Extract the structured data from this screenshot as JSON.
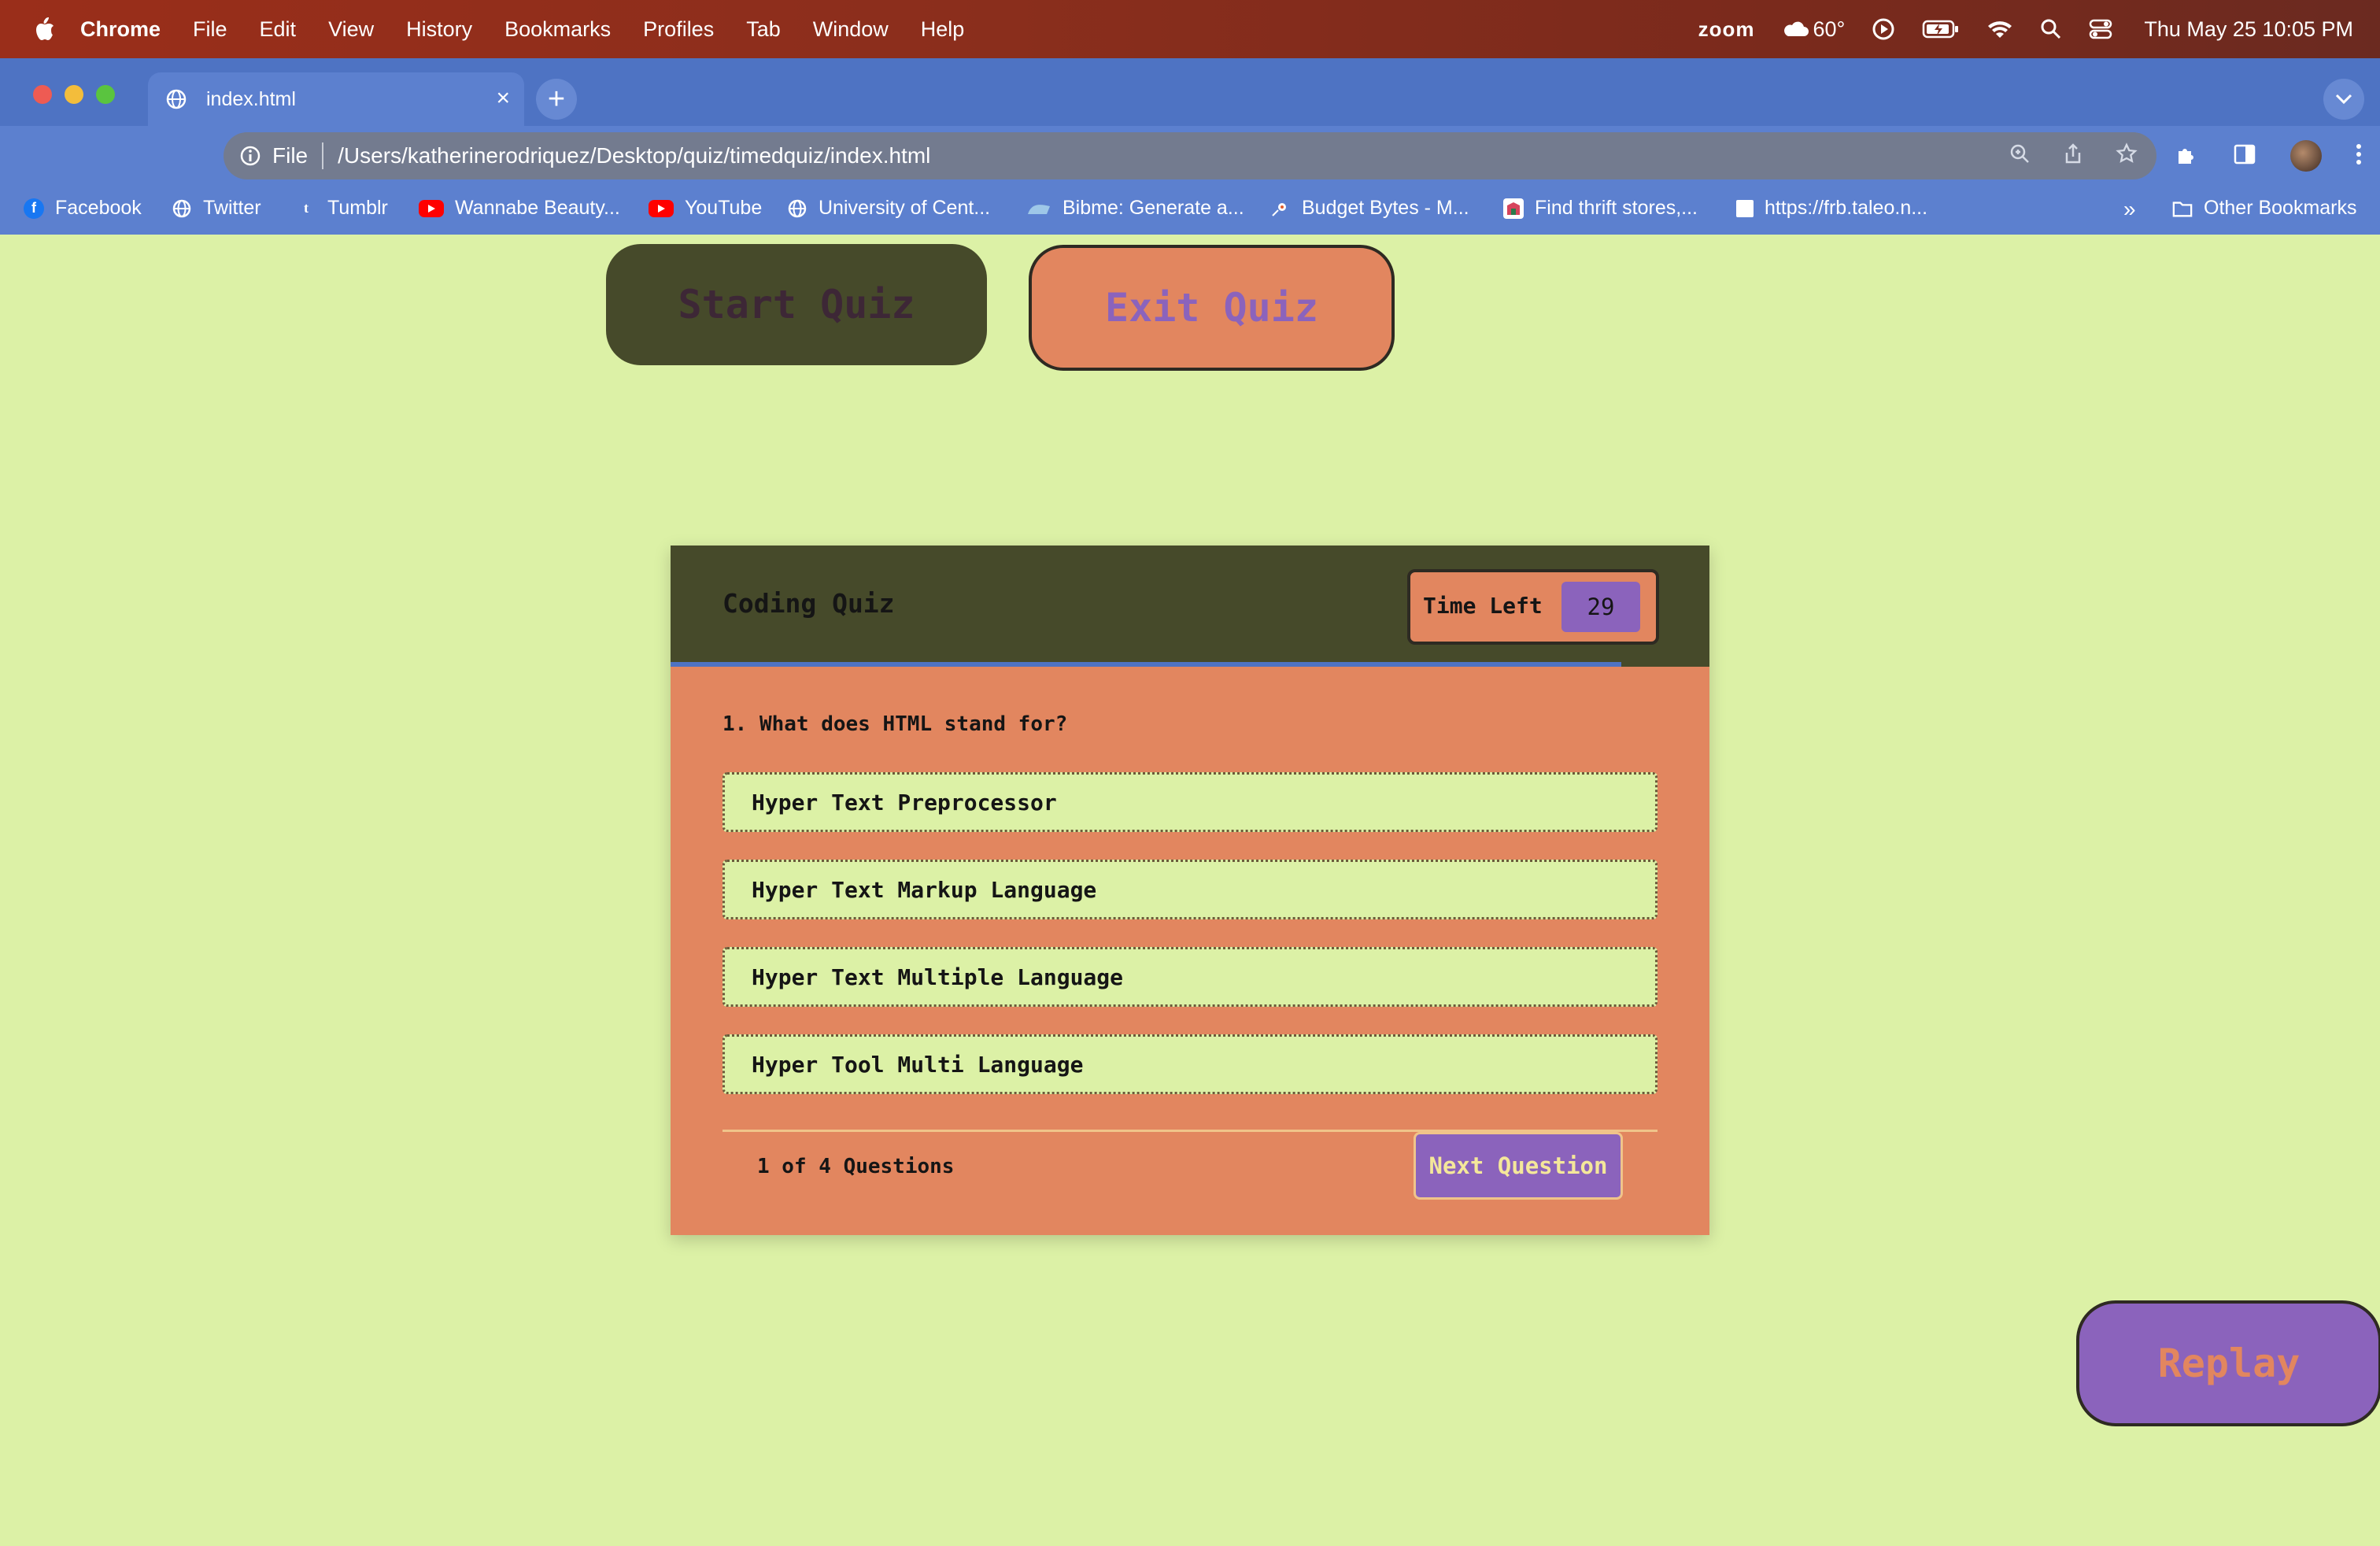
{
  "menubar": {
    "app_name": "Chrome",
    "menus": [
      "File",
      "Edit",
      "View",
      "History",
      "Bookmarks",
      "Profiles",
      "Tab",
      "Window",
      "Help"
    ],
    "status_zoom": "zoom",
    "weather": "60°",
    "clock": "Thu May 25  10:05 PM"
  },
  "browser": {
    "tab_title": "index.html",
    "new_tab_symbol": "+",
    "address_scheme": "File",
    "address_url": "/Users/katherinerodriquez/Desktop/quiz/timedquiz/index.html",
    "bookmarks": [
      {
        "label": "Facebook",
        "icon": "facebook-icon",
        "color": "#1877f2"
      },
      {
        "label": "Twitter",
        "icon": "globe-icon",
        "color": "#ffffff"
      },
      {
        "label": "Tumblr",
        "icon": "tumblr-icon",
        "color": "#36465d"
      },
      {
        "label": "Wannabe Beauty...",
        "icon": "youtube-icon",
        "color": "#ff0000"
      },
      {
        "label": "YouTube",
        "icon": "youtube-icon",
        "color": "#ff0000"
      },
      {
        "label": "University of Cent...",
        "icon": "globe-icon",
        "color": "#ffffff"
      },
      {
        "label": "Bibme: Generate a...",
        "icon": "bibme-icon",
        "color": "#9ec7e8"
      },
      {
        "label": "Budget Bytes - M...",
        "icon": "budgetbytes-icon",
        "color": "#ffffff"
      },
      {
        "label": "Find thrift stores,...",
        "icon": "thrift-icon",
        "color": "#d6445c"
      },
      {
        "label": "https://frb.taleo.n...",
        "icon": "page-icon",
        "color": "#ffffff"
      }
    ],
    "overflow_label": "»",
    "other_bookmarks": "Other Bookmarks"
  },
  "page": {
    "start_button": "Start Quiz",
    "exit_button": "Exit Quiz",
    "replay_button": "Replay",
    "quiz": {
      "title": "Coding Quiz",
      "timer_label": "Time Left",
      "timer_value": "29",
      "progress_fraction": 0.915,
      "question": "1. What does HTML stand for?",
      "options": [
        "Hyper Text Preprocessor",
        "Hyper Text Markup Language",
        "Hyper Text Multiple Language",
        "Hyper Tool Multi Language"
      ],
      "count_text": "1 of 4 Questions",
      "next_button": "Next Question"
    }
  },
  "colors": {
    "page_bg": "#dcf1a6",
    "quiz_bg": "#e2865f",
    "header_bg": "#464a2a",
    "accent_purple": "#8b63bc",
    "chrome_blue": "#4e73c3"
  }
}
